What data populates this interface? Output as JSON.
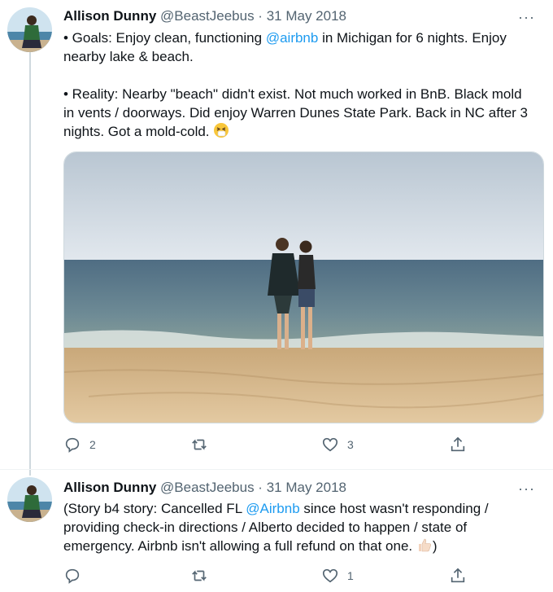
{
  "tweets": [
    {
      "name": "Allison Dunny",
      "handle": "@BeastJeebus",
      "date": "31 May 2018",
      "separator": "·",
      "more_label": "···",
      "p1_prefix": "• Goals: Enjoy clean, functioning ",
      "p1_mention": "@airbnb",
      "p1_suffix": " in Michigan for 6 nights. Enjoy nearby lake & beach.",
      "p2": "• Reality: Nearby \"beach\" didn't exist. Not much worked in BnB. Black mold in vents / doorways. Did enjoy Warren Dunes State Park. Back in NC after 3 nights. Got a mold-cold.",
      "p2_emoji": "sneezing-face-icon",
      "replies": "2",
      "retweets": "",
      "likes": "3"
    },
    {
      "name": "Allison Dunny",
      "handle": "@BeastJeebus",
      "date": "31 May 2018",
      "separator": "·",
      "more_label": "···",
      "text_prefix": "(Story b4 story: Cancelled FL ",
      "text_mention": "@Airbnb",
      "text_suffix": " since host wasn't responding / providing check-in directions / Alberto decided to happen / state of emergency. Airbnb isn't allowing a full refund on that one.",
      "text_emoji": "thumbs-up-icon",
      "text_end": ")",
      "replies": "",
      "retweets": "",
      "likes": "1"
    }
  ],
  "colors": {
    "accent": "#1d9bf0",
    "muted": "#536471",
    "text": "#0f1419",
    "line": "#cfd9de"
  }
}
